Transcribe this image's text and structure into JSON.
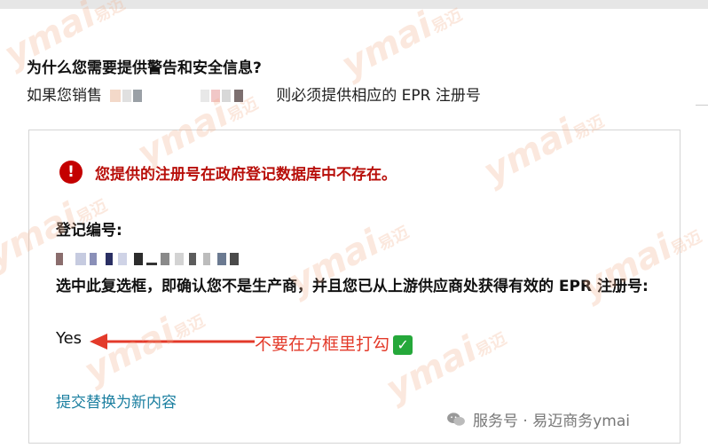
{
  "heading": "为什么您需要提供警告和安全信息?",
  "subline": {
    "prefix": "如果您销售",
    "suffix": "则必须提供相应的 EPR 注册号"
  },
  "alert": {
    "icon": "!",
    "icon_name": "error-icon",
    "message": "您提供的注册号在政府登记数据库中不存在。",
    "color": "#b80f0a"
  },
  "registration": {
    "label": "登记编号:"
  },
  "confirm": {
    "text": "选中此复选框，即确认您不是生产商，并且您已从上游供应商处获得有效的 EPR 注册号:",
    "value": "Yes"
  },
  "annotation": {
    "text": "不要在方框里打勾",
    "check": "✓",
    "color": "#e33a2a"
  },
  "submit_link": "提交替换为新内容",
  "footer_watermark": "服务号 · 易迈商务ymai",
  "watermark": {
    "logo": "ymai",
    "brand": "易迈"
  }
}
